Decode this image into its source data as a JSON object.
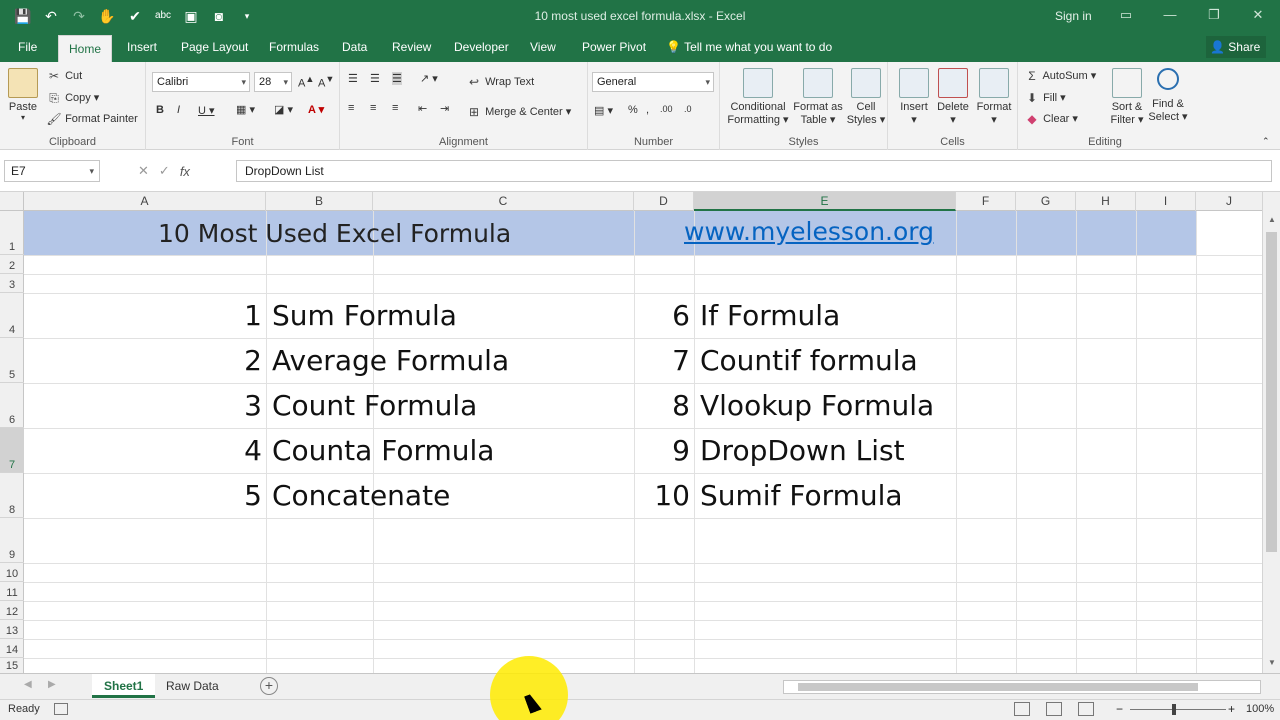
{
  "window": {
    "title": "10 most used excel formula.xlsx  -  Excel",
    "signin": "Sign in"
  },
  "tabs": [
    "File",
    "Home",
    "Insert",
    "Page Layout",
    "Formulas",
    "Data",
    "Review",
    "Developer",
    "View",
    "Power Pivot"
  ],
  "tellme": "Tell me what you want to do",
  "share": "Share",
  "ribbon": {
    "clipboard": {
      "name": "Clipboard",
      "paste": "Paste",
      "cut": "Cut",
      "copy": "Copy",
      "format_painter": "Format Painter"
    },
    "font": {
      "name": "Font",
      "family": "Calibri",
      "size": "28"
    },
    "alignment": {
      "name": "Alignment",
      "wrap": "Wrap Text",
      "merge": "Merge & Center"
    },
    "number": {
      "name": "Number",
      "format": "General"
    },
    "styles": {
      "name": "Styles",
      "cond1": "Conditional",
      "cond2": "Formatting",
      "fmt1": "Format as",
      "fmt2": "Table",
      "cell1": "Cell",
      "cell2": "Styles"
    },
    "cells": {
      "name": "Cells",
      "insert": "Insert",
      "delete": "Delete",
      "format": "Format"
    },
    "editing": {
      "name": "Editing",
      "autosum": "AutoSum",
      "fill": "Fill",
      "clear": "Clear",
      "sort1": "Sort &",
      "sort2": "Filter",
      "find1": "Find &",
      "find2": "Select"
    }
  },
  "formula_bar": {
    "name_box": "E7",
    "fx": "fx",
    "content": "DropDown List"
  },
  "columns": [
    "A",
    "B",
    "C",
    "D",
    "E",
    "F",
    "G",
    "H",
    "I",
    "J"
  ],
  "rows": [
    "1",
    "2",
    "3",
    "4",
    "5",
    "6",
    "7",
    "8",
    "9",
    "10",
    "11",
    "12",
    "13",
    "14",
    "15"
  ],
  "sheet": {
    "title": "10 Most Used Excel Formula",
    "link": "www.myelesson.org",
    "left_list": [
      {
        "n": "1",
        "label": "Sum Formula"
      },
      {
        "n": "2",
        "label": "Average Formula"
      },
      {
        "n": "3",
        "label": "Count Formula"
      },
      {
        "n": "4",
        "label": "Counta Formula"
      },
      {
        "n": "5",
        "label": "Concatenate"
      }
    ],
    "right_list": [
      {
        "n": "6",
        "label": "If Formula"
      },
      {
        "n": "7",
        "label": "Countif formula"
      },
      {
        "n": "8",
        "label": "Vlookup Formula"
      },
      {
        "n": "9",
        "label": "DropDown List"
      },
      {
        "n": "10",
        "label": "Sumif Formula"
      }
    ]
  },
  "sheet_tabs": [
    "Sheet1",
    "Raw Data"
  ],
  "status": {
    "ready": "Ready",
    "zoom": "100%"
  },
  "colors": {
    "excel_green": "#217346",
    "banner": "#b4c6e7",
    "link": "#0563c1"
  }
}
